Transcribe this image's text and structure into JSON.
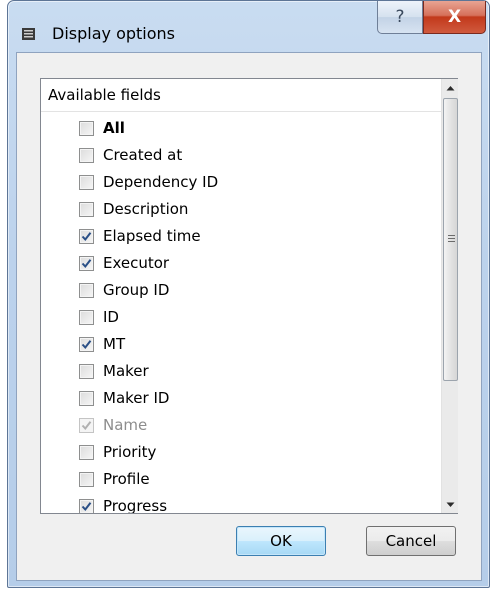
{
  "window": {
    "title": "Display options",
    "help_label": "?",
    "close_label": "X"
  },
  "list": {
    "header": "Available fields",
    "items": [
      {
        "label": "All",
        "checked": false,
        "bold": true,
        "disabled": false
      },
      {
        "label": "Created at",
        "checked": false,
        "bold": false,
        "disabled": false
      },
      {
        "label": "Dependency ID",
        "checked": false,
        "bold": false,
        "disabled": false
      },
      {
        "label": "Description",
        "checked": false,
        "bold": false,
        "disabled": false
      },
      {
        "label": "Elapsed time",
        "checked": true,
        "bold": false,
        "disabled": false
      },
      {
        "label": "Executor",
        "checked": true,
        "bold": false,
        "disabled": false
      },
      {
        "label": "Group ID",
        "checked": false,
        "bold": false,
        "disabled": false
      },
      {
        "label": "ID",
        "checked": false,
        "bold": false,
        "disabled": false
      },
      {
        "label": "MT",
        "checked": true,
        "bold": false,
        "disabled": false
      },
      {
        "label": "Maker",
        "checked": false,
        "bold": false,
        "disabled": false
      },
      {
        "label": "Maker ID",
        "checked": false,
        "bold": false,
        "disabled": false
      },
      {
        "label": "Name",
        "checked": true,
        "bold": false,
        "disabled": true
      },
      {
        "label": "Priority",
        "checked": false,
        "bold": false,
        "disabled": false
      },
      {
        "label": "Profile",
        "checked": false,
        "bold": false,
        "disabled": false
      },
      {
        "label": "Progress",
        "checked": true,
        "bold": false,
        "disabled": false
      }
    ]
  },
  "buttons": {
    "ok": "OK",
    "cancel": "Cancel"
  },
  "colors": {
    "check_mark": "#2a4f86",
    "check_mark_disabled": "#b0b0b0"
  }
}
